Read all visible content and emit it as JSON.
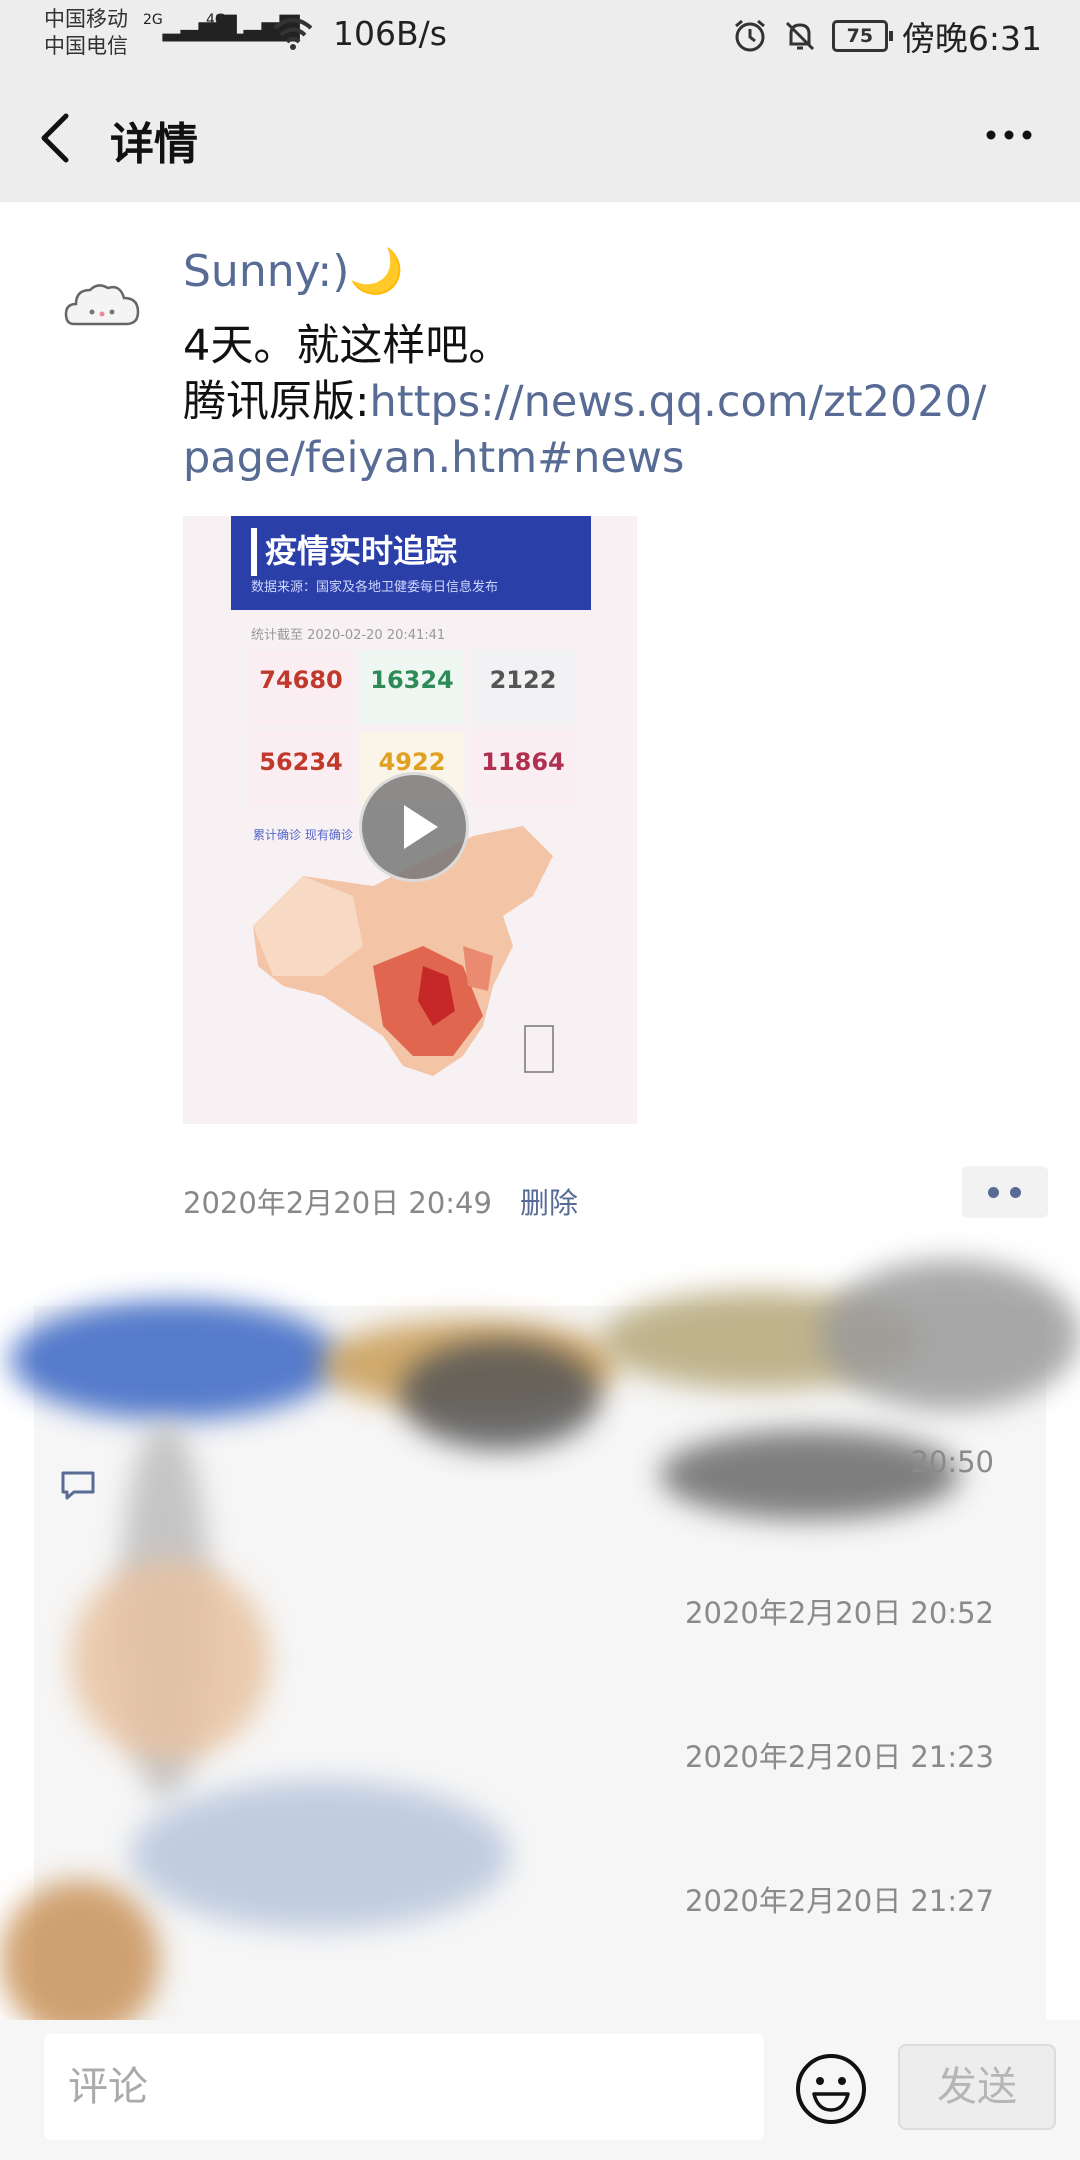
{
  "status_bar": {
    "carrier_1": "中国移动",
    "carrier_2": "中国电信",
    "net_1": "2G",
    "net_2": "4G",
    "speed": "106B/s",
    "battery": "75",
    "time": "傍晚6:31"
  },
  "header": {
    "back_icon": "chevron-left-icon",
    "title": "详情",
    "more_icon": "more-horizontal-icon"
  },
  "post": {
    "author": "Sunny:)🌙",
    "line1": "4天。就这样吧。",
    "link_prefix": "腾讯原版:",
    "link": "https://news.qq.com/zt2020/page/feiyan.htm#news",
    "video": {
      "header_title": "疫情实时追踪",
      "header_sub": "数据来源：国家及各地卫健委每日信息发布",
      "updated": "统计截至 2020-02-20 20:41:41",
      "stats": [
        {
          "num": "74680",
          "color": "#c0392b"
        },
        {
          "num": "16324",
          "color": "#2e8b57"
        },
        {
          "num": "2122",
          "color": "#555555"
        },
        {
          "num": "56234",
          "color": "#c0392b"
        },
        {
          "num": "4922",
          "color": "#e0a020"
        },
        {
          "num": "11864",
          "color": "#b03050"
        }
      ],
      "map_tabs": "累计确诊   现有确诊",
      "play_icon": "play-icon"
    },
    "time": "2020年2月20日 20:49",
    "delete": "删除",
    "action_icon": "like-comment-icon"
  },
  "comments": {
    "icon": "comment-icon",
    "times": [
      "20:50",
      "2020年2月20日 20:52",
      "2020年2月20日 21:23",
      "2020年2月20日 21:27"
    ]
  },
  "input_bar": {
    "placeholder": "评论",
    "emoji_icon": "emoji-icon",
    "send": "发送"
  },
  "colors": {
    "link": "#576b95",
    "bar_bg": "#ededed"
  }
}
